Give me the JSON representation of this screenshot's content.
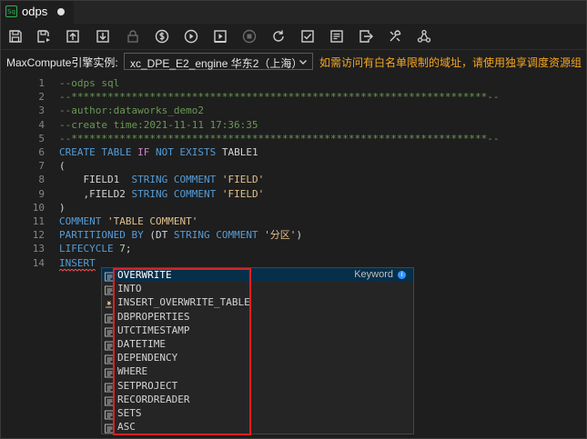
{
  "tab": {
    "icon_text": "Sq",
    "title": "odps"
  },
  "toolbar": {
    "buttons": [
      {
        "icon": "save-icon"
      },
      {
        "icon": "save-as-icon"
      },
      {
        "icon": "upload-icon"
      },
      {
        "icon": "download-icon"
      },
      {
        "icon": "lock-icon"
      },
      {
        "icon": "cost-icon"
      },
      {
        "icon": "run-icon"
      },
      {
        "icon": "run-with-params-icon"
      },
      {
        "icon": "stop-icon"
      },
      {
        "icon": "refresh-icon"
      },
      {
        "icon": "check-icon"
      },
      {
        "icon": "format-icon"
      },
      {
        "icon": "export-icon"
      },
      {
        "icon": "tools-icon"
      },
      {
        "icon": "graph-icon"
      }
    ]
  },
  "engine": {
    "label": "MaxCompute引擎实例:",
    "selected": "xc_DPE_E2_engine 华东2（上海）",
    "notice": "如需访问有白名单限制的域址，请使用独享调度资源组"
  },
  "editor": {
    "lines": [
      {
        "n": "1",
        "segs": [
          {
            "t": "--odps sql",
            "c": "cm"
          }
        ]
      },
      {
        "n": "2",
        "segs": [
          {
            "t": "--*********************************************************************--",
            "c": "cm"
          }
        ]
      },
      {
        "n": "3",
        "segs": [
          {
            "t": "--author:dataworks_demo2",
            "c": "cm"
          }
        ]
      },
      {
        "n": "4",
        "segs": [
          {
            "t": "--create time:2021-11-11 17:36:35",
            "c": "cm"
          }
        ]
      },
      {
        "n": "5",
        "segs": [
          {
            "t": "--*********************************************************************--",
            "c": "cm"
          }
        ]
      },
      {
        "n": "6",
        "segs": [
          {
            "t": "CREATE TABLE ",
            "c": "kw"
          },
          {
            "t": "IF ",
            "c": "kw2"
          },
          {
            "t": "NOT EXISTS ",
            "c": "kw"
          },
          {
            "t": "TABLE1",
            "c": "ident"
          }
        ]
      },
      {
        "n": "7",
        "segs": [
          {
            "t": "(",
            "c": "ident"
          }
        ]
      },
      {
        "n": "8",
        "segs": [
          {
            "t": "    FIELD1  ",
            "c": "ident"
          },
          {
            "t": "STRING COMMENT ",
            "c": "kw"
          },
          {
            "t": "'FIELD'",
            "c": "str"
          }
        ]
      },
      {
        "n": "9",
        "segs": [
          {
            "t": "    ,FIELD2 ",
            "c": "ident"
          },
          {
            "t": "STRING COMMENT ",
            "c": "kw"
          },
          {
            "t": "'FIELD'",
            "c": "str"
          }
        ]
      },
      {
        "n": "10",
        "segs": [
          {
            "t": ")",
            "c": "ident"
          }
        ]
      },
      {
        "n": "11",
        "segs": [
          {
            "t": "COMMENT ",
            "c": "kw"
          },
          {
            "t": "'TABLE COMMENT'",
            "c": "str"
          }
        ]
      },
      {
        "n": "12",
        "segs": [
          {
            "t": "PARTITIONED BY ",
            "c": "kw"
          },
          {
            "t": "(DT ",
            "c": "ident"
          },
          {
            "t": "STRING COMMENT ",
            "c": "kw"
          },
          {
            "t": "'分区'",
            "c": "str"
          },
          {
            "t": ")",
            "c": "ident"
          }
        ]
      },
      {
        "n": "13",
        "segs": [
          {
            "t": "LIFECYCLE ",
            "c": "kw"
          },
          {
            "t": "7",
            "c": "num"
          },
          {
            "t": ";",
            "c": "ident"
          }
        ]
      },
      {
        "n": "14",
        "segs": [
          {
            "t": "INSERT ",
            "c": "kw"
          }
        ]
      }
    ]
  },
  "suggest": {
    "detail": "Keyword",
    "info": "i",
    "items": [
      {
        "label": "OVERWRITE",
        "icon": "keyword-icon"
      },
      {
        "label": "INTO",
        "icon": "keyword-icon"
      },
      {
        "label": "INSERT_OVERWRITE_TABLE",
        "icon": "snippet-icon"
      },
      {
        "label": "DBPROPERTIES",
        "icon": "keyword-icon"
      },
      {
        "label": "UTCTIMESTAMP",
        "icon": "keyword-icon"
      },
      {
        "label": "DATETIME",
        "icon": "keyword-icon"
      },
      {
        "label": "DEPENDENCY",
        "icon": "keyword-icon"
      },
      {
        "label": "WHERE",
        "icon": "keyword-icon"
      },
      {
        "label": "SETPROJECT",
        "icon": "keyword-icon"
      },
      {
        "label": "RECORDREADER",
        "icon": "keyword-icon"
      },
      {
        "label": "SETS",
        "icon": "keyword-icon"
      },
      {
        "label": "ASC",
        "icon": "keyword-icon"
      }
    ]
  },
  "colors": {
    "notice": "#f5a623",
    "highlight": "#e02020",
    "selection": "#062f4a"
  }
}
